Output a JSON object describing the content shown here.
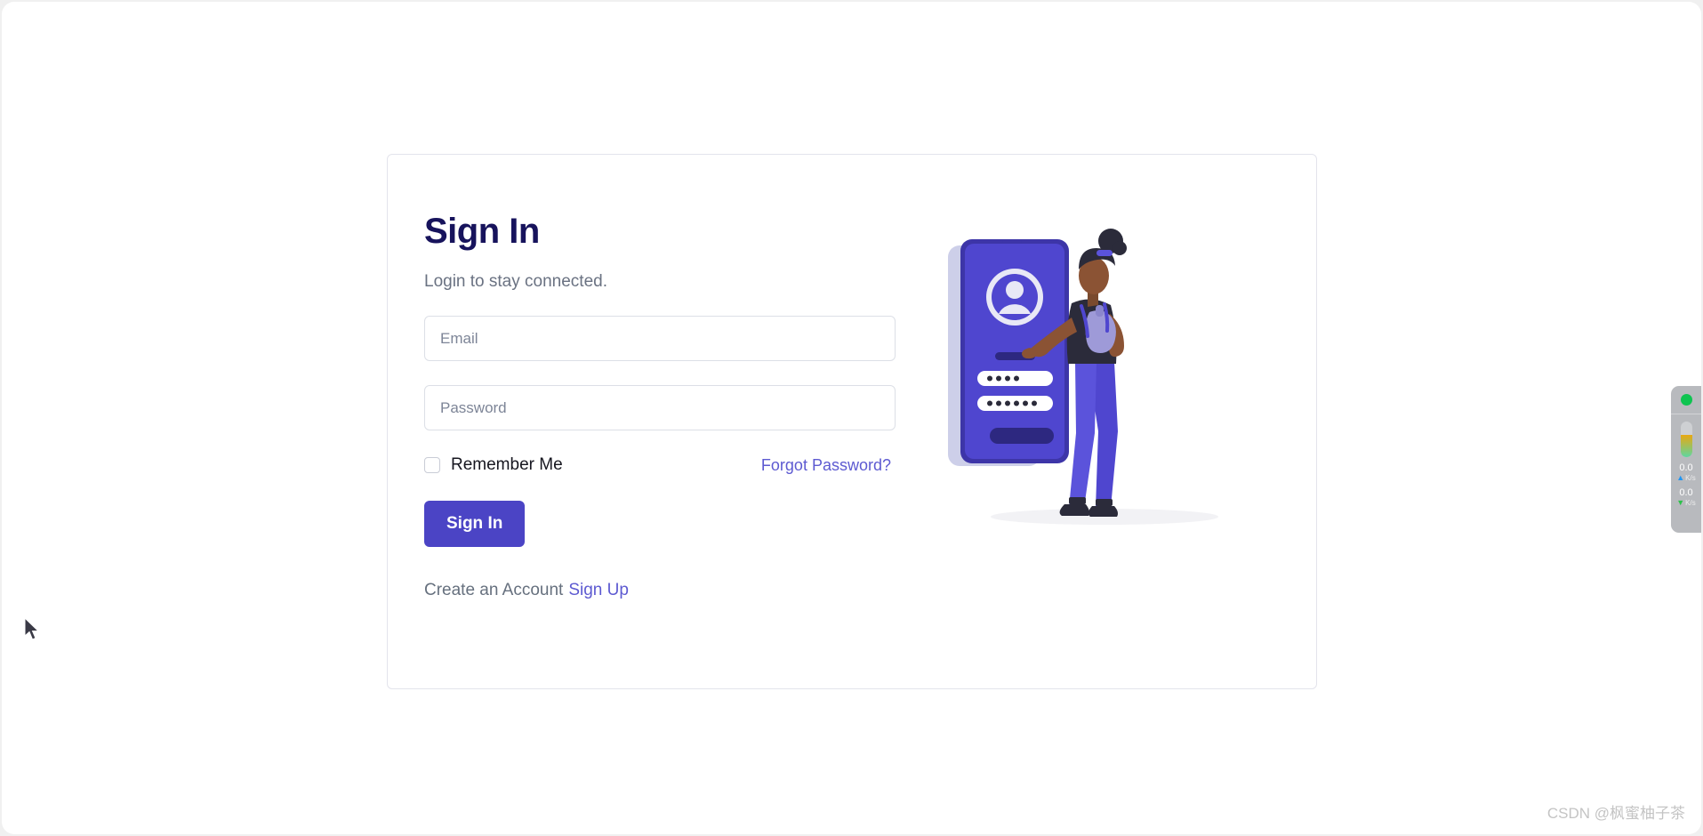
{
  "card": {
    "title": "Sign In",
    "subtitle": "Login to stay connected.",
    "email": {
      "value": "",
      "placeholder": "Email"
    },
    "password": {
      "value": "",
      "placeholder": "Password"
    },
    "remember_label": "Remember Me",
    "forgot_label": "Forgot Password?",
    "submit_label": "Sign In",
    "create_account_text": "Create an Account",
    "signup_label": "Sign Up"
  },
  "illustration": {
    "name": "login-illustration",
    "description": "woman standing beside large phone showing login screen",
    "phone_dots_field_1": 4,
    "phone_dots_field_2": 6
  },
  "net_widget": {
    "status": "online",
    "memory_fill_percent": 62,
    "upload": {
      "value": "0.0",
      "unit": "K/s",
      "arrow": "up-arrow-icon"
    },
    "download": {
      "value": "0.0",
      "unit": "K/s",
      "arrow": "down-arrow-icon"
    }
  },
  "watermark": "CSDN @枫蜜柚子茶",
  "colors": {
    "accent": "#4b44c5",
    "link": "#5d5ad1",
    "title": "#17135c",
    "muted": "#6a7282",
    "border": "#dcdfe6",
    "status_green": "#0ec450"
  }
}
